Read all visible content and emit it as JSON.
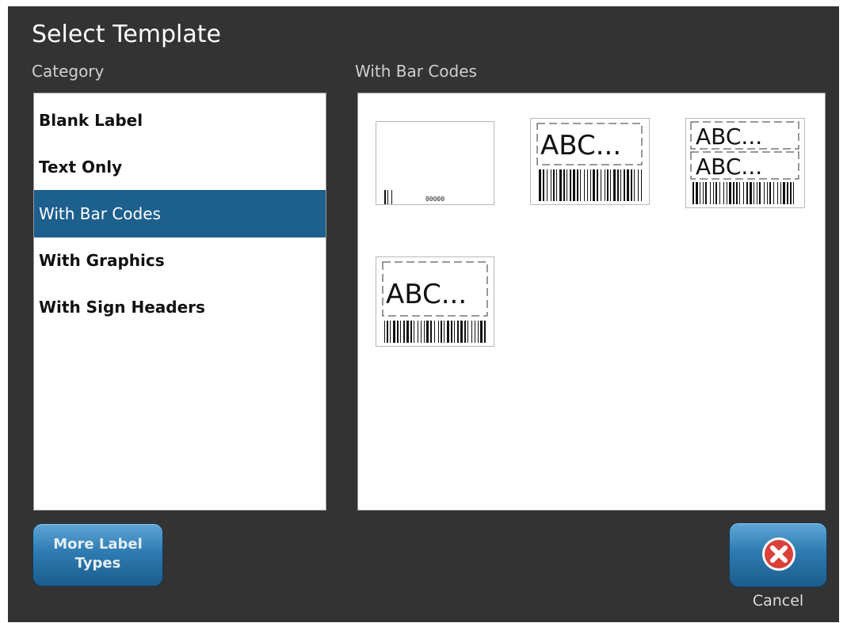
{
  "dialog": {
    "title": "Select Template"
  },
  "category": {
    "heading": "Category",
    "items": [
      {
        "label": "Blank Label",
        "selected": false
      },
      {
        "label": "Text Only",
        "selected": false
      },
      {
        "label": "With Bar Codes",
        "selected": true
      },
      {
        "label": "With Graphics",
        "selected": false
      },
      {
        "label": "With Sign Headers",
        "selected": false
      }
    ]
  },
  "templates": {
    "heading": "With Bar Codes",
    "items": [
      {
        "kind": "barcode-only",
        "caption": "00000"
      },
      {
        "kind": "text-barcode",
        "text": "ABC..."
      },
      {
        "kind": "two-text-barcode",
        "text": "ABC..."
      },
      {
        "kind": "tall-text-barcode",
        "text": "ABC..."
      }
    ]
  },
  "buttons": {
    "more_label_types_line1": "More Label",
    "more_label_types_line2": "Types",
    "cancel_label": "Cancel",
    "cancel_icon": "close-circle-icon"
  },
  "colors": {
    "background": "#333333",
    "selection": "#1d5f8d",
    "button_blue": "#2e7bb2",
    "cancel_red": "#d9413a"
  }
}
